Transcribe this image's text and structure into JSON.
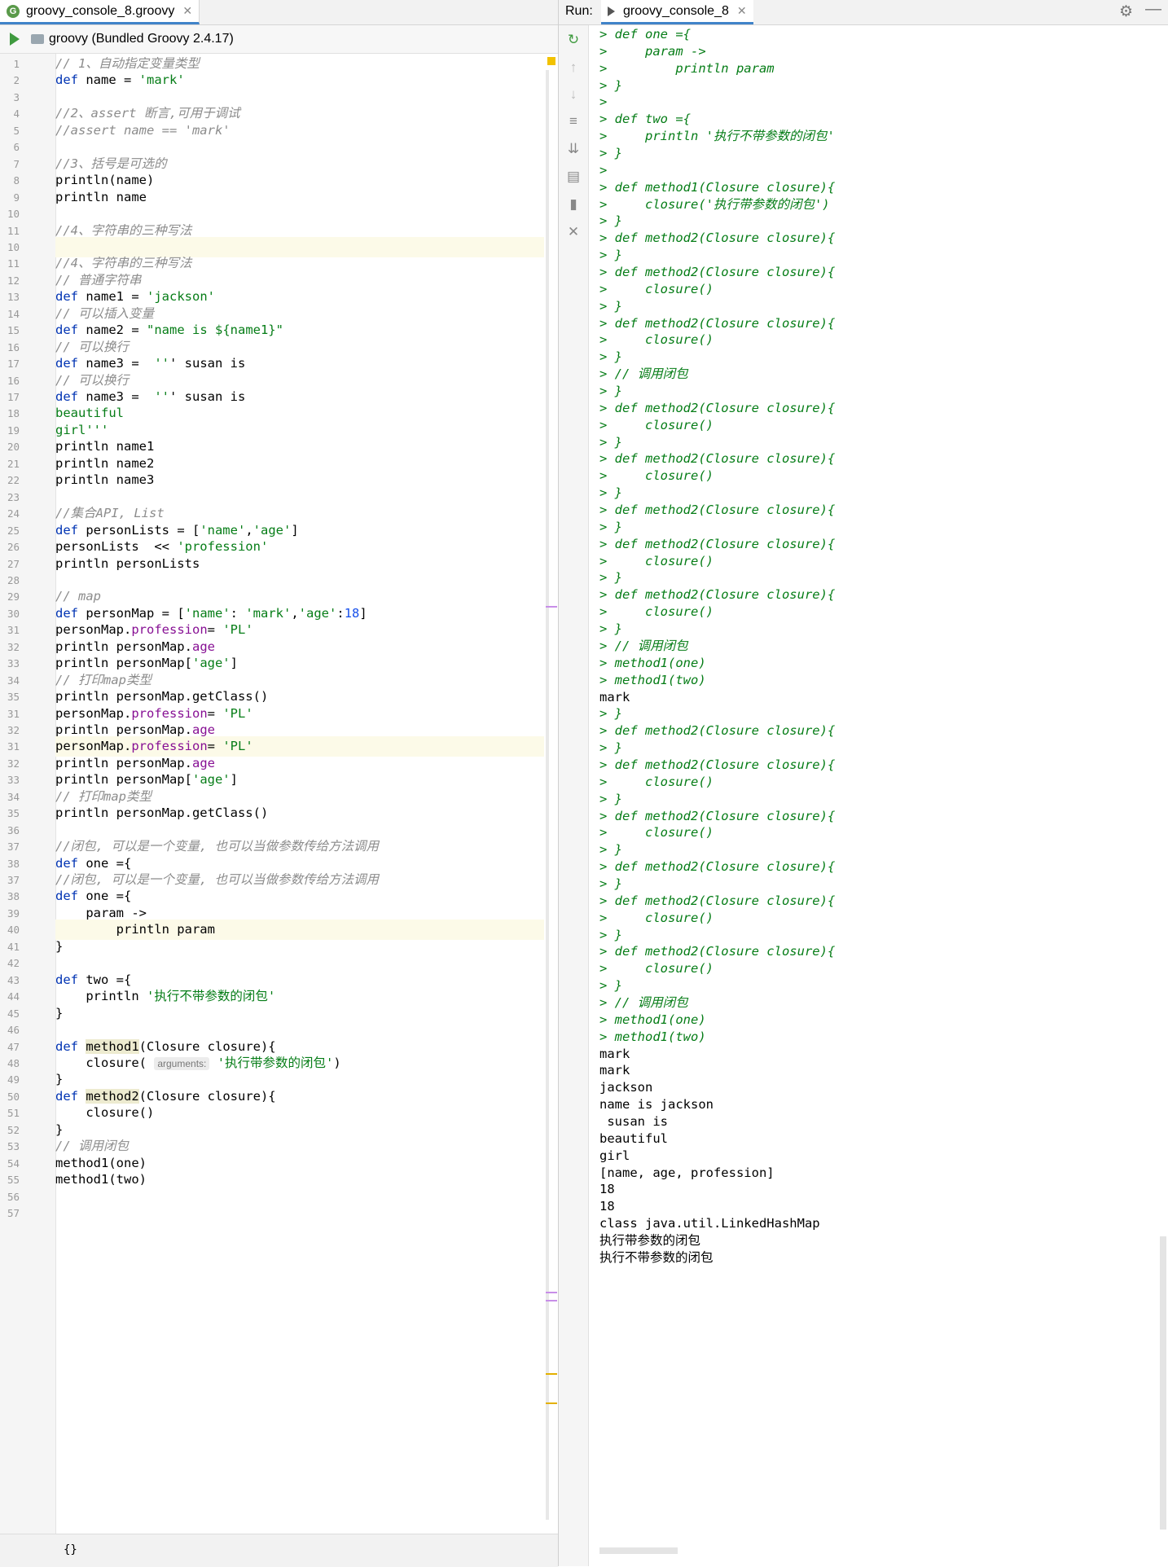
{
  "editor": {
    "tab_label": "groovy_console_8.groovy",
    "toolbar_label": "groovy (Bundled Groovy 2.4.17)",
    "status_text": "{}",
    "lines": [
      {
        "n": "1",
        "t": "// 1、自动指定变量类型",
        "c": "cmt"
      },
      {
        "n": "2",
        "t": "def name = 'mark'",
        "c": "code"
      },
      {
        "n": "3",
        "t": "",
        "c": "code"
      },
      {
        "n": "4",
        "t": "//2、assert 断言,可用于调试",
        "c": "cmt"
      },
      {
        "n": "5",
        "t": "//assert name == 'mark'",
        "c": "cmt"
      },
      {
        "n": "6",
        "t": "",
        "c": "code"
      },
      {
        "n": "7",
        "t": "//3、括号是可选的",
        "c": "cmt"
      },
      {
        "n": "8",
        "t": "println(name)",
        "c": "code"
      },
      {
        "n": "9",
        "t": "println name",
        "c": "code"
      },
      {
        "n": "10",
        "t": "",
        "c": "code"
      },
      {
        "n": "11",
        "t": "//4、字符串的三种写法",
        "c": "cmt"
      },
      {
        "n": "10",
        "t": "",
        "c": "hl"
      },
      {
        "n": "11",
        "t": "//4、字符串的三种写法",
        "c": "cmt"
      },
      {
        "n": "12",
        "t": "// 普通字符串",
        "c": "cmt"
      },
      {
        "n": "13",
        "t": "def name1 = 'jackson'",
        "c": "code"
      },
      {
        "n": "14",
        "t": "// 可以插入变量",
        "c": "cmt"
      },
      {
        "n": "15",
        "t": "def name2 = \"name is ${name1}\"",
        "c": "code"
      },
      {
        "n": "16",
        "t": "// 可以换行",
        "c": "cmt"
      },
      {
        "n": "17",
        "t": "def name3 =  ''' susan is",
        "c": "code"
      },
      {
        "n": "16",
        "t": "// 可以换行",
        "c": "cmt"
      },
      {
        "n": "17",
        "t": "def name3 =  ''' susan is",
        "c": "code"
      },
      {
        "n": "18",
        "t": "beautiful",
        "c": "str"
      },
      {
        "n": "19",
        "t": "girl'''",
        "c": "str"
      },
      {
        "n": "20",
        "t": "println name1",
        "c": "code"
      },
      {
        "n": "21",
        "t": "println name2",
        "c": "code"
      },
      {
        "n": "22",
        "t": "println name3",
        "c": "code"
      },
      {
        "n": "23",
        "t": "",
        "c": "code"
      },
      {
        "n": "24",
        "t": "//集合API, List",
        "c": "cmt"
      },
      {
        "n": "25",
        "t": "def personLists = ['name','age']",
        "c": "code"
      },
      {
        "n": "26",
        "t": "personLists  << 'profession'",
        "c": "code"
      },
      {
        "n": "27",
        "t": "println personLists",
        "c": "code"
      },
      {
        "n": "28",
        "t": "",
        "c": "code"
      },
      {
        "n": "29",
        "t": "// map",
        "c": "cmt"
      },
      {
        "n": "30",
        "t": "def personMap = ['name': 'mark','age':18]",
        "c": "code"
      },
      {
        "n": "31",
        "t": "personMap.profession= 'PL'",
        "c": "code"
      },
      {
        "n": "32",
        "t": "println personMap.age",
        "c": "code"
      },
      {
        "n": "33",
        "t": "println personMap['age']",
        "c": "code"
      },
      {
        "n": "34",
        "t": "// 打印map类型",
        "c": "cmt"
      },
      {
        "n": "35",
        "t": "println personMap.getClass()",
        "c": "code"
      },
      {
        "n": "31",
        "t": "personMap.profession= 'PL'",
        "c": "code"
      },
      {
        "n": "32",
        "t": "println personMap.age",
        "c": "code"
      },
      {
        "n": "31",
        "t": "personMap.profession= 'PL'",
        "c": "hl"
      },
      {
        "n": "32",
        "t": "println personMap.age",
        "c": "code"
      },
      {
        "n": "33",
        "t": "println personMap['age']",
        "c": "code"
      },
      {
        "n": "34",
        "t": "// 打印map类型",
        "c": "cmt"
      },
      {
        "n": "35",
        "t": "println personMap.getClass()",
        "c": "code"
      },
      {
        "n": "36",
        "t": "",
        "c": "code"
      },
      {
        "n": "37",
        "t": "//闭包, 可以是一个变量, 也可以当做参数传给方法调用",
        "c": "cmt"
      },
      {
        "n": "38",
        "t": "def one ={",
        "c": "code"
      },
      {
        "n": "37",
        "t": "//闭包, 可以是一个变量, 也可以当做参数传给方法调用",
        "c": "cmt"
      },
      {
        "n": "38",
        "t": "def one ={",
        "c": "code"
      },
      {
        "n": "39",
        "t": "    param ->",
        "c": "code"
      },
      {
        "n": "40",
        "t": "        println param",
        "c": "hl"
      },
      {
        "n": "41",
        "t": "}",
        "c": "code"
      },
      {
        "n": "42",
        "t": "",
        "c": "code"
      },
      {
        "n": "43",
        "t": "def two ={",
        "c": "code"
      },
      {
        "n": "44",
        "t": "    println '执行不带参数的闭包'",
        "c": "code"
      },
      {
        "n": "45",
        "t": "}",
        "c": "code"
      },
      {
        "n": "46",
        "t": "",
        "c": "code"
      },
      {
        "n": "47",
        "t": "def method1(Closure closure){",
        "c": "code"
      },
      {
        "n": "48",
        "t": "    closure( arguments: '执行带参数的闭包')",
        "c": "code"
      },
      {
        "n": "49",
        "t": "}",
        "c": "code"
      },
      {
        "n": "50",
        "t": "def method2(Closure closure){",
        "c": "code"
      },
      {
        "n": "51",
        "t": "    closure()",
        "c": "code"
      },
      {
        "n": "52",
        "t": "}",
        "c": "code"
      },
      {
        "n": "53",
        "t": "// 调用闭包",
        "c": "cmt"
      },
      {
        "n": "54",
        "t": "method1(one)",
        "c": "code"
      },
      {
        "n": "55",
        "t": "method1(two)",
        "c": "code"
      },
      {
        "n": "56",
        "t": "",
        "c": "code"
      },
      {
        "n": "57",
        "t": "",
        "c": "code"
      }
    ]
  },
  "run": {
    "label": "Run:",
    "tab_label": "groovy_console_8",
    "console": [
      {
        "t": "> def one ={",
        "k": "in"
      },
      {
        "t": ">     param ->",
        "k": "in"
      },
      {
        "t": ">         println param",
        "k": "in"
      },
      {
        "t": "> }",
        "k": "in"
      },
      {
        "t": ">",
        "k": "in"
      },
      {
        "t": "> def two ={",
        "k": "in"
      },
      {
        "t": ">     println '执行不带参数的闭包'",
        "k": "in"
      },
      {
        "t": "> }",
        "k": "in"
      },
      {
        "t": ">",
        "k": "in"
      },
      {
        "t": "> def method1(Closure closure){",
        "k": "in"
      },
      {
        "t": ">     closure('执行带参数的闭包')",
        "k": "in"
      },
      {
        "t": "> }",
        "k": "in"
      },
      {
        "t": "> def method2(Closure closure){",
        "k": "in"
      },
      {
        "t": "> }",
        "k": "in"
      },
      {
        "t": "> def method2(Closure closure){",
        "k": "in"
      },
      {
        "t": ">     closure()",
        "k": "in"
      },
      {
        "t": "> }",
        "k": "in"
      },
      {
        "t": "> def method2(Closure closure){",
        "k": "in"
      },
      {
        "t": ">     closure()",
        "k": "in"
      },
      {
        "t": "> }",
        "k": "in"
      },
      {
        "t": "> // 调用闭包",
        "k": "in"
      },
      {
        "t": "> }",
        "k": "in"
      },
      {
        "t": "> def method2(Closure closure){",
        "k": "in"
      },
      {
        "t": ">     closure()",
        "k": "in"
      },
      {
        "t": "> }",
        "k": "in"
      },
      {
        "t": "> def method2(Closure closure){",
        "k": "in"
      },
      {
        "t": ">     closure()",
        "k": "in"
      },
      {
        "t": "> }",
        "k": "in"
      },
      {
        "t": "> def method2(Closure closure){",
        "k": "in"
      },
      {
        "t": "> }",
        "k": "in"
      },
      {
        "t": "> def method2(Closure closure){",
        "k": "in"
      },
      {
        "t": ">     closure()",
        "k": "in"
      },
      {
        "t": "> }",
        "k": "in"
      },
      {
        "t": "> def method2(Closure closure){",
        "k": "in"
      },
      {
        "t": ">     closure()",
        "k": "in"
      },
      {
        "t": "> }",
        "k": "in"
      },
      {
        "t": "> // 调用闭包",
        "k": "in"
      },
      {
        "t": "> method1(one)",
        "k": "in"
      },
      {
        "t": "> method1(two)",
        "k": "in"
      },
      {
        "t": "mark",
        "k": "out"
      },
      {
        "t": "> }",
        "k": "in"
      },
      {
        "t": "> def method2(Closure closure){",
        "k": "in"
      },
      {
        "t": "> }",
        "k": "in"
      },
      {
        "t": "> def method2(Closure closure){",
        "k": "in"
      },
      {
        "t": ">     closure()",
        "k": "in"
      },
      {
        "t": "> }",
        "k": "in"
      },
      {
        "t": "> def method2(Closure closure){",
        "k": "in"
      },
      {
        "t": ">     closure()",
        "k": "in"
      },
      {
        "t": "> }",
        "k": "in"
      },
      {
        "t": "> def method2(Closure closure){",
        "k": "in"
      },
      {
        "t": "> }",
        "k": "in"
      },
      {
        "t": "> def method2(Closure closure){",
        "k": "in"
      },
      {
        "t": ">     closure()",
        "k": "in"
      },
      {
        "t": "> }",
        "k": "in"
      },
      {
        "t": "> def method2(Closure closure){",
        "k": "in"
      },
      {
        "t": ">     closure()",
        "k": "in"
      },
      {
        "t": "> }",
        "k": "in"
      },
      {
        "t": "> // 调用闭包",
        "k": "in"
      },
      {
        "t": "> method1(one)",
        "k": "in"
      },
      {
        "t": "> method1(two)",
        "k": "in"
      },
      {
        "t": "mark",
        "k": "out"
      },
      {
        "t": "mark",
        "k": "out"
      },
      {
        "t": "jackson",
        "k": "out"
      },
      {
        "t": "name is jackson",
        "k": "out"
      },
      {
        "t": " susan is",
        "k": "out"
      },
      {
        "t": "beautiful",
        "k": "out"
      },
      {
        "t": "girl",
        "k": "out"
      },
      {
        "t": "[name, age, profession]",
        "k": "out"
      },
      {
        "t": "18",
        "k": "out"
      },
      {
        "t": "18",
        "k": "out"
      },
      {
        "t": "class java.util.LinkedHashMap",
        "k": "out"
      },
      {
        "t": "执行带参数的闭包",
        "k": "out"
      },
      {
        "t": "执行不带参数的闭包",
        "k": "out"
      }
    ]
  },
  "icons": [
    "groovy-file-icon",
    "close-icon",
    "run-icon",
    "module-icon",
    "rerun-icon",
    "arrow-up-icon",
    "arrow-down-icon",
    "soft-wrap-icon",
    "scroll-to-end-icon",
    "print-icon",
    "trash-icon",
    "close-icon",
    "gear-icon",
    "minimize-icon"
  ],
  "colors": {
    "keyword": "#0033b3",
    "string": "#067d17",
    "comment": "#8c8c8c",
    "number": "#1750eb",
    "console_input": "#067d17"
  }
}
